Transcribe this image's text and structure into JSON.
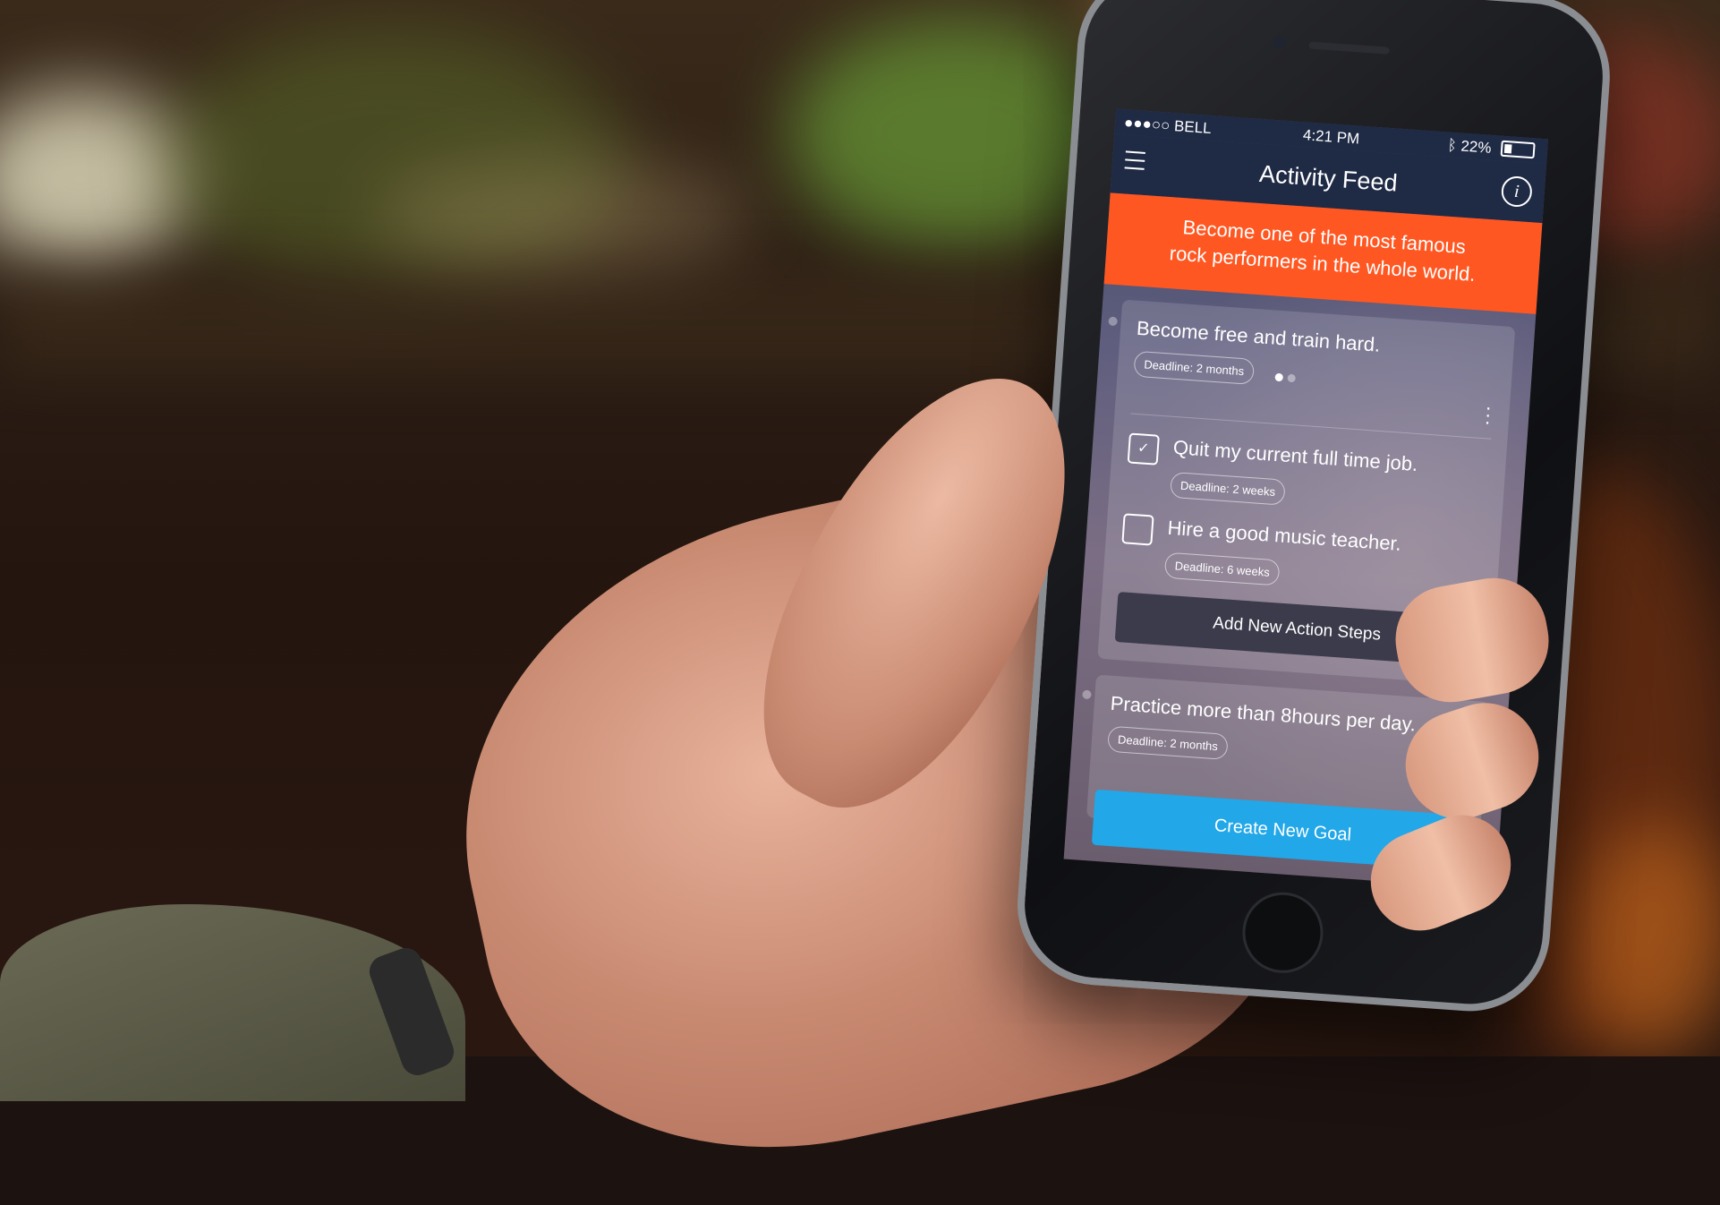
{
  "status_bar": {
    "carrier": "●●●○○ BELL",
    "time": "4:21 PM",
    "battery": "22%"
  },
  "nav": {
    "title": "Activity Feed"
  },
  "banner": {
    "line1": "Become one of the most famous",
    "line2": "rock performers in the whole world."
  },
  "goals": [
    {
      "title": "Become free and train hard.",
      "deadline": "Deadline: 2 months",
      "steps": [
        {
          "label": "Quit my current full time job.",
          "deadline": "Deadline: 2 weeks",
          "checked": true
        },
        {
          "label": "Hire a good music teacher.",
          "deadline": "Deadline: 6 weeks",
          "checked": false
        }
      ],
      "add_steps_label": "Add New Action Steps"
    },
    {
      "title": "Practice more than 8hours per day.",
      "deadline": "Deadline: 2 months"
    }
  ],
  "create_goal_label": "Create New Goal",
  "colors": {
    "navbar": "#1f2a45",
    "banner": "#ff5722",
    "primary_button": "#22a7e8"
  }
}
